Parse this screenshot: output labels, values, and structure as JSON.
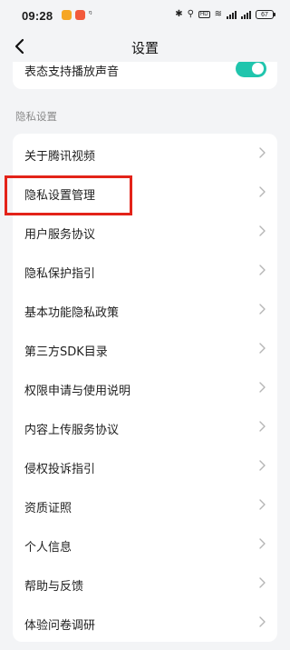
{
  "status_bar": {
    "time": "09:28",
    "signal_text": "Sıll",
    "battery_level": "67"
  },
  "nav": {
    "title": "设置"
  },
  "top_card": {
    "label": "表态支持播放声音",
    "toggle_on": true
  },
  "section": {
    "header": "隐私设置"
  },
  "privacy_items": [
    "关于腾讯视频",
    "隐私设置管理",
    "用户服务协议",
    "隐私保护指引",
    "基本功能隐私政策",
    "第三方SDK目录",
    "权限申请与使用说明",
    "内容上传服务协议",
    "侵权投诉指引",
    "资质证照",
    "个人信息",
    "帮助与反馈",
    "体验问卷调研"
  ],
  "colors": {
    "toggle_active": "#20c5ad",
    "highlight": "#e32319",
    "background": "#f3f4f6"
  }
}
